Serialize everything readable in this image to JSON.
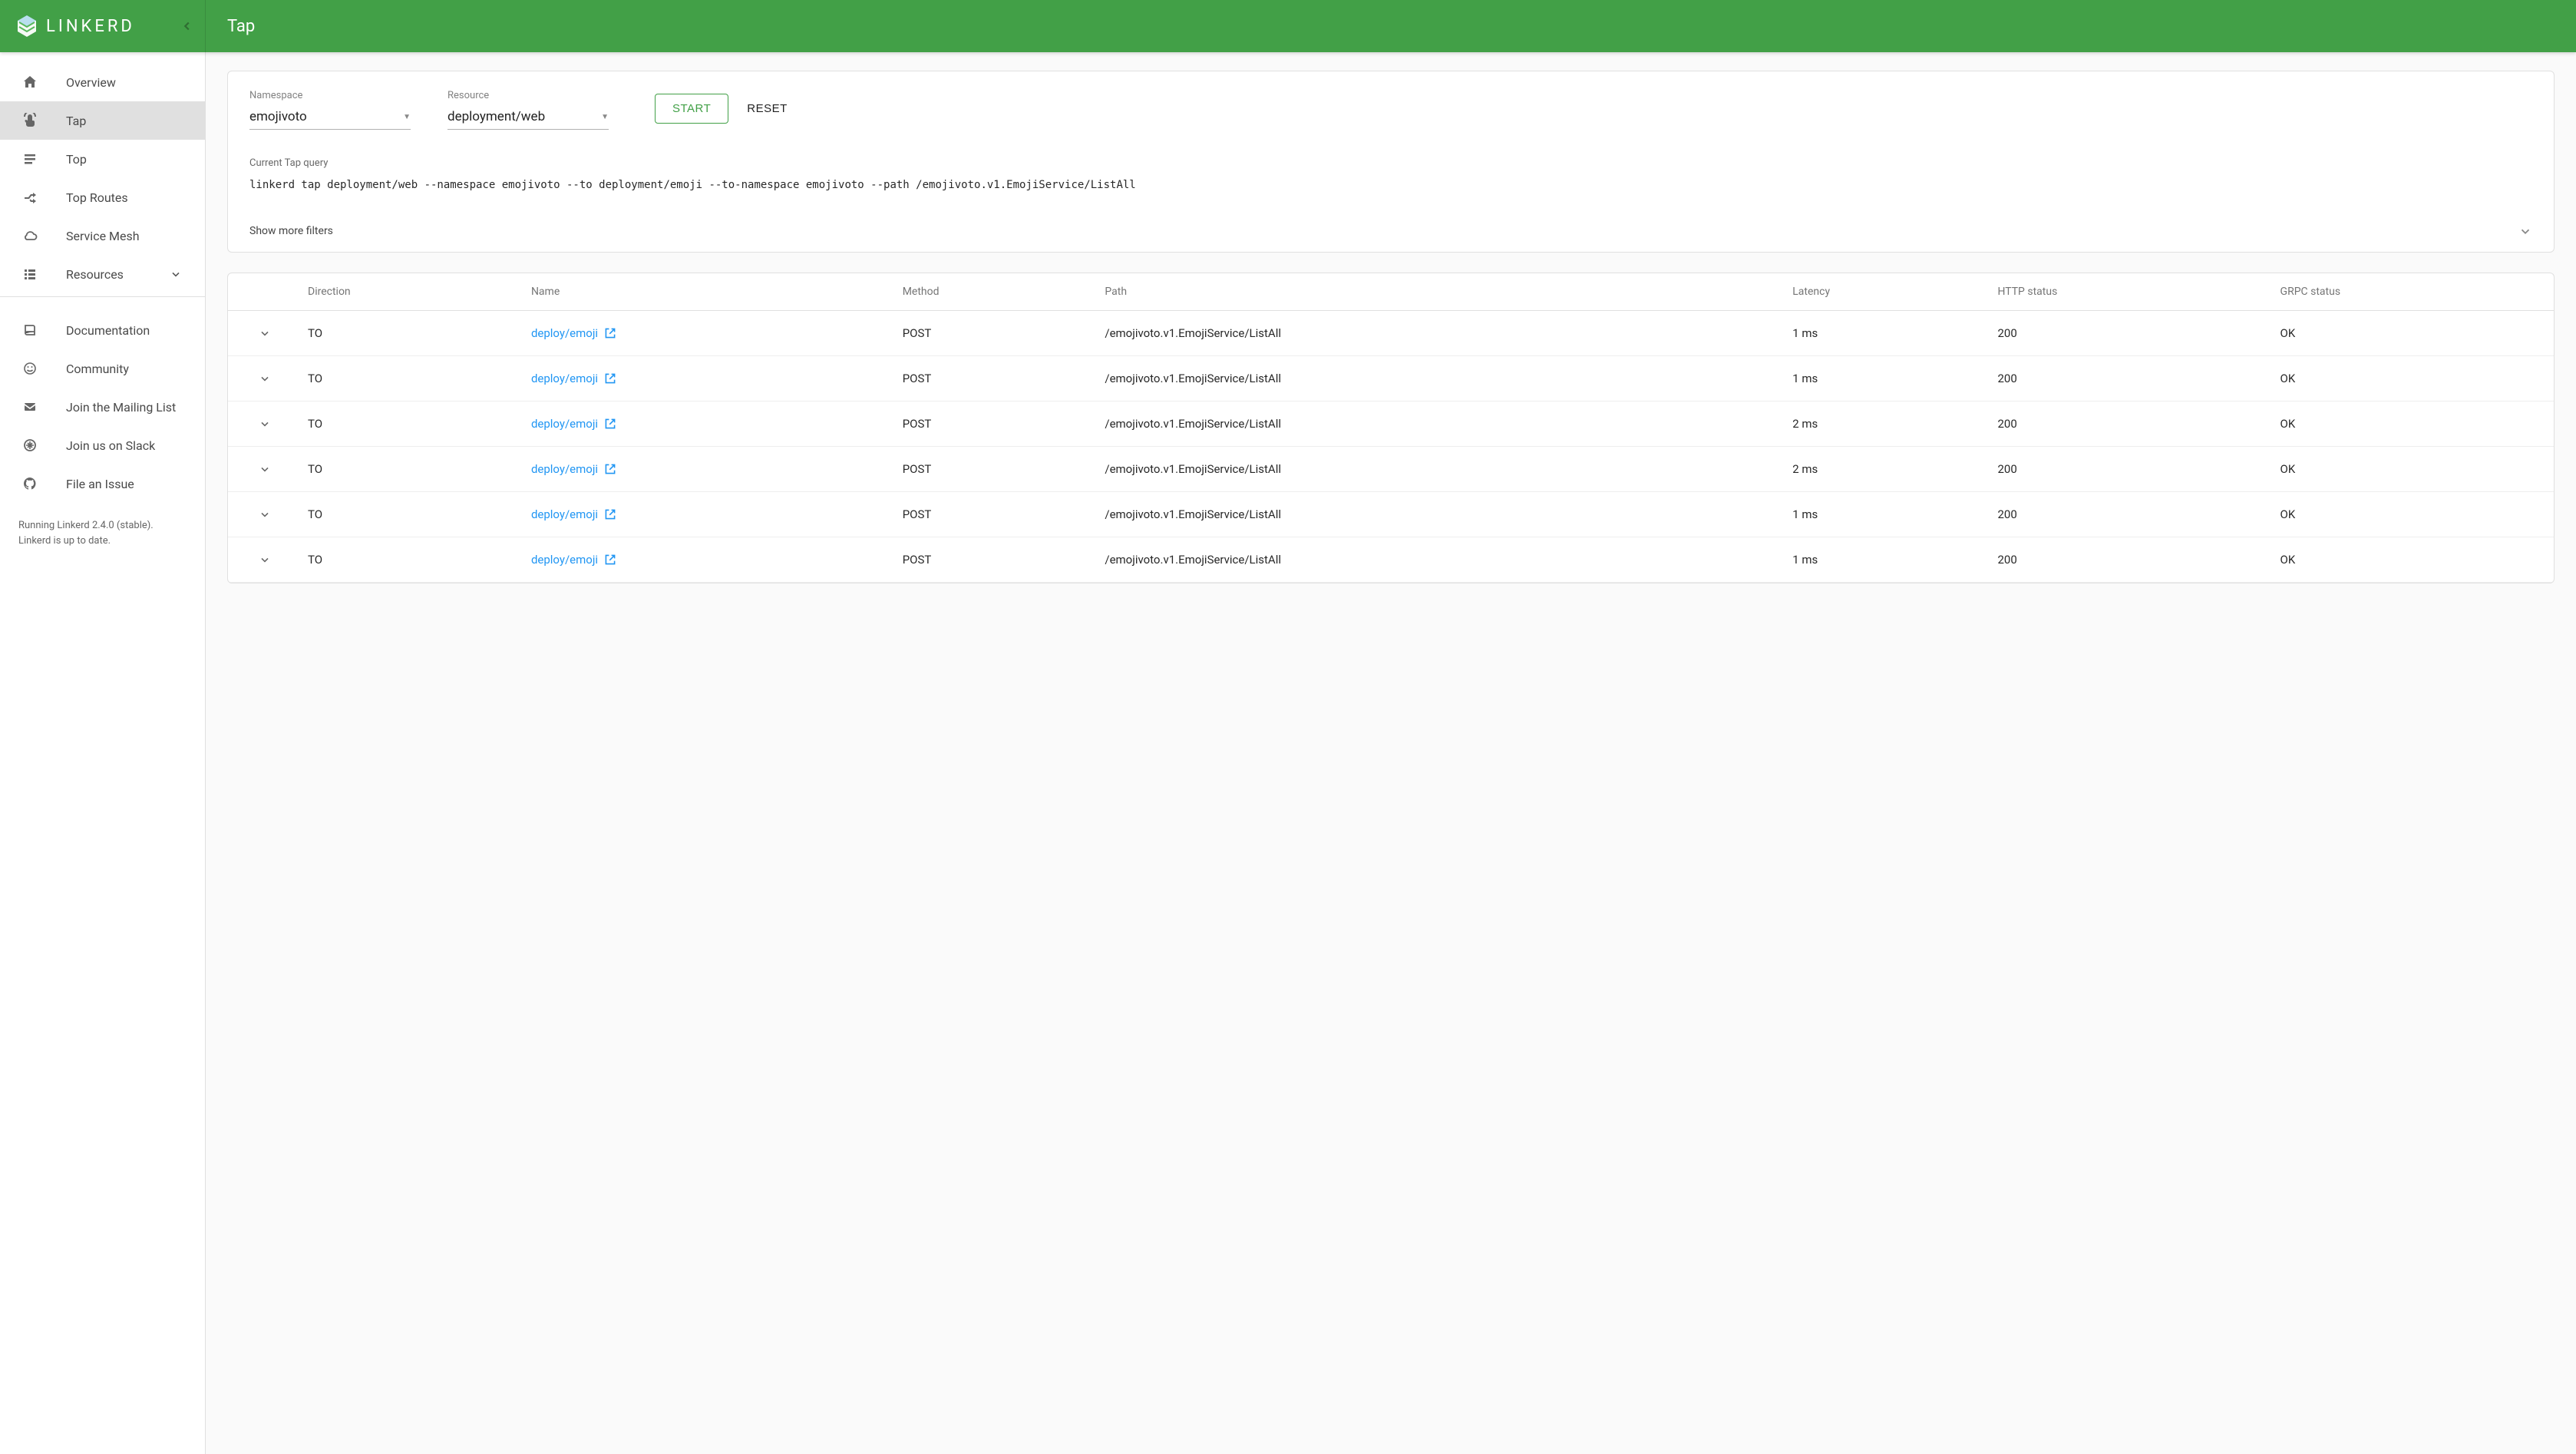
{
  "brand": {
    "text": "LINKERD"
  },
  "page": {
    "title": "Tap"
  },
  "sidebar": {
    "groups": [
      [
        {
          "label": "Overview",
          "icon": "home",
          "active": false
        },
        {
          "label": "Tap",
          "icon": "tap",
          "active": true
        },
        {
          "label": "Top",
          "icon": "bars",
          "active": false
        },
        {
          "label": "Top Routes",
          "icon": "shuffle",
          "active": false
        },
        {
          "label": "Service Mesh",
          "icon": "cloud",
          "active": false
        },
        {
          "label": "Resources",
          "icon": "list",
          "active": false,
          "expandable": true
        }
      ],
      [
        {
          "label": "Documentation",
          "icon": "book",
          "active": false
        },
        {
          "label": "Community",
          "icon": "smile",
          "active": false
        },
        {
          "label": "Join the Mailing List",
          "icon": "mail",
          "active": false
        },
        {
          "label": "Join us on Slack",
          "icon": "slack",
          "active": false
        },
        {
          "label": "File an Issue",
          "icon": "github",
          "active": false
        }
      ]
    ],
    "footer_line1": "Running Linkerd 2.4.0 (stable).",
    "footer_line2": "Linkerd is up to date."
  },
  "query_form": {
    "namespace_label": "Namespace",
    "namespace_value": "emojivoto",
    "resource_label": "Resource",
    "resource_value": "deployment/web",
    "start_label": "START",
    "reset_label": "RESET",
    "current_label": "Current Tap query",
    "current_text": "linkerd tap deployment/web --namespace emojivoto --to deployment/emoji --to-namespace emojivoto --path /emojivoto.v1.EmojiService/ListAll",
    "show_more": "Show more filters"
  },
  "table": {
    "headers": {
      "direction": "Direction",
      "name": "Name",
      "method": "Method",
      "path": "Path",
      "latency": "Latency",
      "http_status": "HTTP status",
      "grpc_status": "GRPC status"
    },
    "rows": [
      {
        "direction": "TO",
        "name": "deploy/emoji",
        "method": "POST",
        "path": "/emojivoto.v1.EmojiService/ListAll",
        "latency": "1 ms",
        "http_status": "200",
        "grpc_status": "OK"
      },
      {
        "direction": "TO",
        "name": "deploy/emoji",
        "method": "POST",
        "path": "/emojivoto.v1.EmojiService/ListAll",
        "latency": "1 ms",
        "http_status": "200",
        "grpc_status": "OK"
      },
      {
        "direction": "TO",
        "name": "deploy/emoji",
        "method": "POST",
        "path": "/emojivoto.v1.EmojiService/ListAll",
        "latency": "2 ms",
        "http_status": "200",
        "grpc_status": "OK"
      },
      {
        "direction": "TO",
        "name": "deploy/emoji",
        "method": "POST",
        "path": "/emojivoto.v1.EmojiService/ListAll",
        "latency": "2 ms",
        "http_status": "200",
        "grpc_status": "OK"
      },
      {
        "direction": "TO",
        "name": "deploy/emoji",
        "method": "POST",
        "path": "/emojivoto.v1.EmojiService/ListAll",
        "latency": "1 ms",
        "http_status": "200",
        "grpc_status": "OK"
      },
      {
        "direction": "TO",
        "name": "deploy/emoji",
        "method": "POST",
        "path": "/emojivoto.v1.EmojiService/ListAll",
        "latency": "1 ms",
        "http_status": "200",
        "grpc_status": "OK"
      }
    ]
  }
}
